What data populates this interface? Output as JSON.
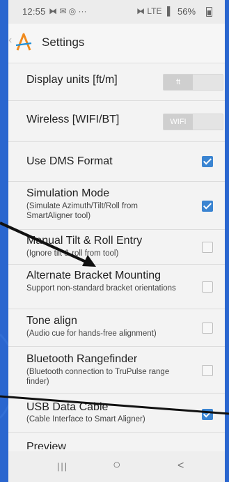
{
  "status_bar": {
    "time": "12:55",
    "left_icons": "⧓ ✉ ◎ ···",
    "right_icons": "⧓ LTE ▐",
    "battery": "56%"
  },
  "app_bar": {
    "title": "Settings"
  },
  "settings": {
    "display_units": {
      "label": "Display units [ft/m]",
      "selected": "ft"
    },
    "wireless": {
      "label": "Wireless [WIFI/BT]",
      "selected": "WIFI"
    },
    "dms": {
      "label": "Use DMS Format",
      "checked": true
    },
    "simulation": {
      "label": "Simulation Mode",
      "sub": "(Simulate Azimuth/Tilt/Roll from SmartAligner tool)",
      "checked": true
    },
    "manual_tilt": {
      "label": "Manual Tilt & Roll Entry",
      "sub": "(Ignore tilt & roll from tool)",
      "checked": false
    },
    "alt_bracket": {
      "label": "Alternate Bracket Mounting",
      "sub": "Support non-standard bracket orientations",
      "checked": false
    },
    "tone_align": {
      "label": "Tone align",
      "sub": "(Audio cue for hands-free alignment)",
      "checked": false
    },
    "bt_rangefinder": {
      "label": "Bluetooth Rangefinder",
      "sub": "(Bluetooth connection to TruPulse range finder)",
      "checked": false
    },
    "usb_cable": {
      "label": "USB Data Cable",
      "sub": "(Cable Interface to Smart Aligner)",
      "checked": true
    },
    "preview": {
      "label": "Preview"
    }
  },
  "nav_bar": {
    "recents": "|||",
    "home": "○",
    "back": "<"
  },
  "colors": {
    "background": "#2a66cf",
    "accent": "#3a84d1",
    "logo_orange": "#f08a1c"
  }
}
